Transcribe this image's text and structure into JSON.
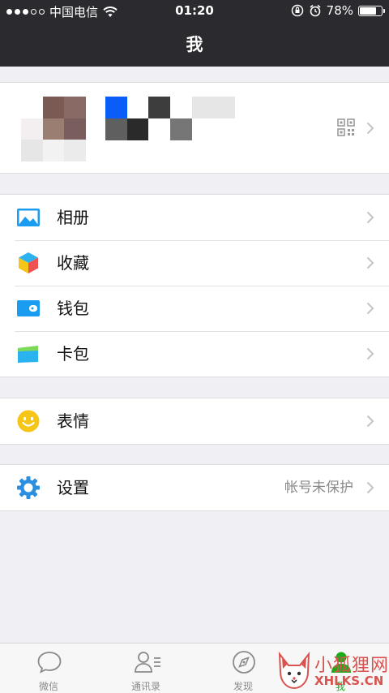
{
  "status_bar": {
    "carrier": "中国电信",
    "time": "01:20",
    "battery_percent": "78%",
    "battery_level": 0.78,
    "signal_dots_filled": 3,
    "signal_dots_total": 5
  },
  "nav": {
    "title": "我"
  },
  "profile": {
    "qr_icon": "qrcode-icon",
    "avatar_colors": [
      "#ffffff",
      "#7a5a52",
      "#8a6a64",
      "#f3eef0",
      "#9b7e72",
      "#7a5d5d",
      "#e6e6e6",
      "#f2f2f2",
      "#ebebeb"
    ],
    "name_colors": [
      "#0a5ef7",
      "#ffffff",
      "#3d3d3d",
      "#ffffff",
      "#e6e6e6",
      "#e6e6e6",
      "#5f5f5f",
      "#2a2a2a",
      "#ffffff",
      "#767676",
      "#ffffff",
      "#ffffff"
    ]
  },
  "menu_groups": [
    {
      "items": [
        {
          "label": "相册",
          "icon": "album-icon",
          "sub": ""
        },
        {
          "label": "收藏",
          "icon": "favorites-icon",
          "sub": ""
        },
        {
          "label": "钱包",
          "icon": "wallet-icon",
          "sub": ""
        },
        {
          "label": "卡包",
          "icon": "card-package-icon",
          "sub": ""
        }
      ]
    },
    {
      "items": [
        {
          "label": "表情",
          "icon": "sticker-icon",
          "sub": ""
        }
      ]
    },
    {
      "items": [
        {
          "label": "设置",
          "icon": "settings-icon",
          "sub": "帐号未保护"
        }
      ]
    }
  ],
  "tabs": [
    {
      "label": "微信",
      "icon": "chat-icon",
      "active": false
    },
    {
      "label": "通讯录",
      "icon": "contacts-icon",
      "active": false
    },
    {
      "label": "发现",
      "icon": "discover-icon",
      "active": false
    },
    {
      "label": "我",
      "icon": "me-icon",
      "active": true
    }
  ],
  "watermark": {
    "line1": "小狐狸网",
    "line2": "XHLKS.CN"
  },
  "colors": {
    "header_bg": "#2b2a2f",
    "page_bg": "#efeff4",
    "accent_green": "#1aad19",
    "album_blue": "#1a9cf0",
    "wallet_blue": "#1a9cf0",
    "settings_blue": "#2b8ee0",
    "sticker_yellow": "#f5c518"
  }
}
